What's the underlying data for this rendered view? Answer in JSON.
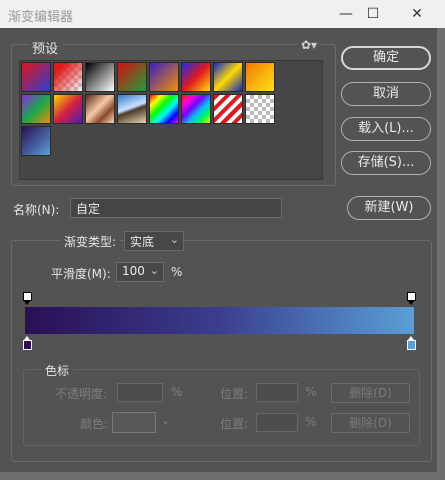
{
  "window": {
    "title": "渐变编辑器",
    "minimize": "—",
    "maximize": "☐",
    "close": "✕"
  },
  "presets": {
    "label": "预设",
    "gear": "✿▾",
    "swatches": [
      {
        "name": "red-blue",
        "bg": "linear-gradient(135deg,#e0141e,#2a3fd0)"
      },
      {
        "name": "red-transparent",
        "bg": "linear-gradient(135deg,#e01a1a 20%,rgba(0,0,0,0) 100%),repeating-conic-gradient(#ccc 0 25%,#fff 0 50%) 0 0/8px 8px"
      },
      {
        "name": "black-white",
        "bg": "linear-gradient(135deg,#000,#fff)"
      },
      {
        "name": "red-green",
        "bg": "linear-gradient(135deg,#d61010,#1a9f3a)"
      },
      {
        "name": "violet-orange",
        "bg": "linear-gradient(135deg,#3b1fbf,#f29000)"
      },
      {
        "name": "blue-red-yellow",
        "bg": "linear-gradient(135deg,#1a2fdf,#e2171e 50%,#ffe000)"
      },
      {
        "name": "blue-yellow-blue",
        "bg": "linear-gradient(135deg,#1028c8,#ffd800 50%,#1028c8)"
      },
      {
        "name": "orange-yellow",
        "bg": "linear-gradient(135deg,#f07a00,#ffe21a)"
      },
      {
        "name": "violet-green-orange",
        "bg": "linear-gradient(135deg,#8a2bd8,#1aa84a 50%,#f08a00)"
      },
      {
        "name": "yellow-violet",
        "bg": "linear-gradient(135deg,#ffd500,#d22040 50%,#4a1fb8)"
      },
      {
        "name": "copper",
        "bg": "linear-gradient(135deg,#5a2e1a,#f7c9a8 45%,#8a4a2a 70%,#fbdcc4)"
      },
      {
        "name": "chrome",
        "bg": "linear-gradient(160deg,#3a78c8,#c8e4ff 45%,#4a3a2a 55%,#e8d8b0)"
      },
      {
        "name": "spectrum-1",
        "bg": "linear-gradient(135deg,#ff0000,#ffff00,#00ff00,#00ffff,#0000ff,#ff00ff)"
      },
      {
        "name": "spectrum-2",
        "bg": "linear-gradient(135deg,#ff1a00,#ff00e0,#7000ff,#00c0ff,#00ff40,#ffee00)"
      },
      {
        "name": "stripes",
        "bg": "repeating-linear-gradient(135deg,#e01a1a 0 4px,#ffffff 4px 8px)"
      },
      {
        "name": "transparent",
        "bg": "repeating-conic-gradient(#bdbdbd 0 25%,#ffffff 0 50%) 0 0/8px 8px"
      },
      {
        "name": "violet-blue",
        "bg": "linear-gradient(135deg,#2a0f55,#5a9fd6)"
      }
    ]
  },
  "buttons": {
    "ok": "确定",
    "cancel": "取消",
    "load": "载入(L)...",
    "save": "存储(S)...",
    "new": "新建(W)"
  },
  "name": {
    "label": "名称(N):",
    "value": "自定"
  },
  "gradient": {
    "type_label": "渐变类型:",
    "type_value": "实底",
    "smooth_label": "平滑度(M):",
    "smooth_value": "100",
    "percent": "%",
    "stops": {
      "left_color": "#2a0f55",
      "right_color": "#5a9fd6"
    }
  },
  "color_stops": {
    "label": "色标",
    "opacity_label": "不透明度:",
    "opacity_unit": "%",
    "position_label_1": "位置:",
    "position_unit_1": "%",
    "delete_1": "删除(D)",
    "color_label": "颜色:",
    "position_label_2": "位置:",
    "position_unit_2": "%",
    "delete_2": "删除(D)"
  }
}
